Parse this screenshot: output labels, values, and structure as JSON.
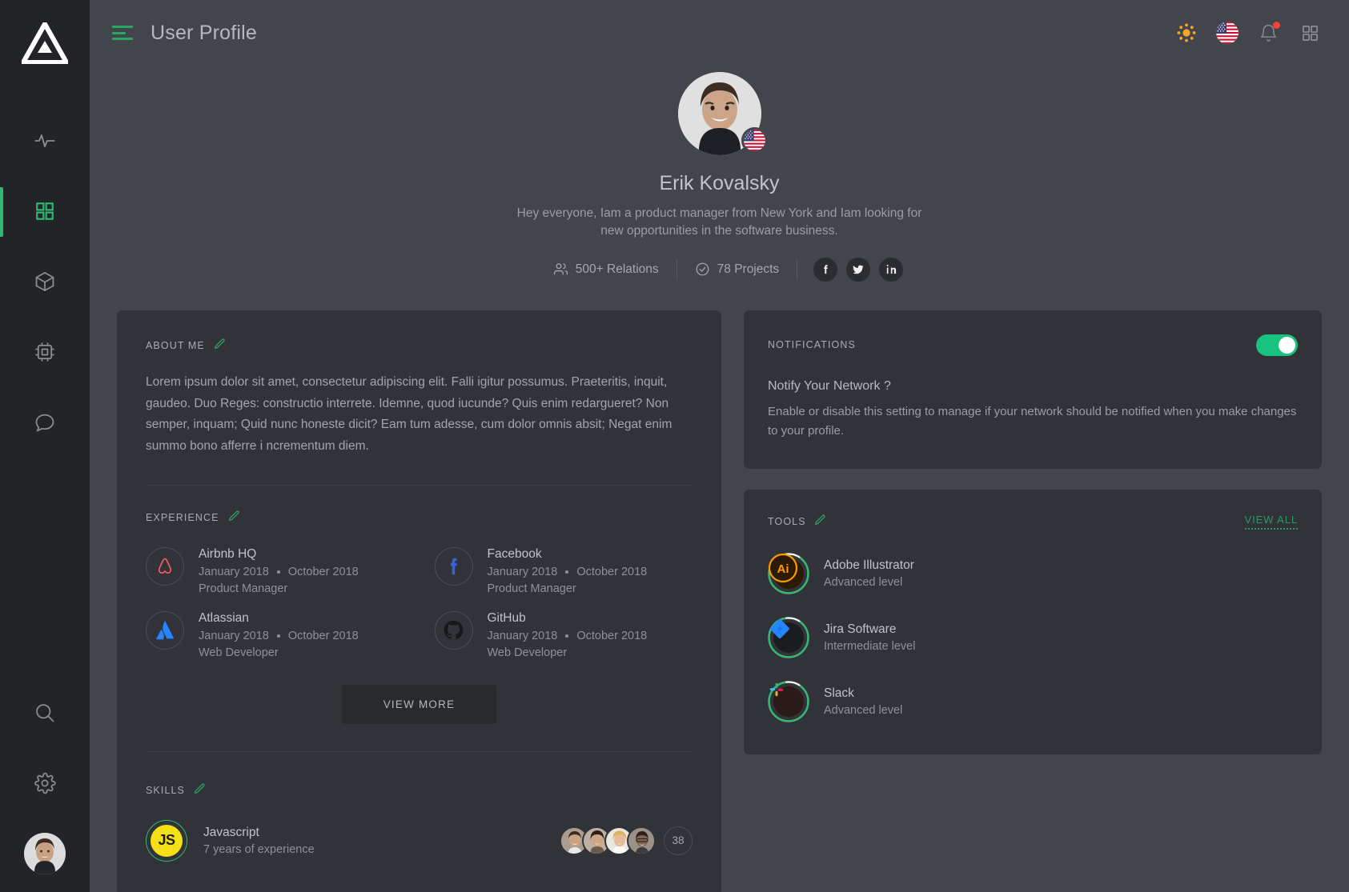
{
  "colors": {
    "accent": "#2eb872",
    "page_bg": "#43454d",
    "sidebar_bg": "#232427",
    "card_bg": "#313338",
    "toggle_on": "#18c37d",
    "notification_dot": "#f0453a"
  },
  "sidebar": {
    "logo": "triangle-logo",
    "items": [
      {
        "icon": "activity-icon",
        "name": "activity",
        "active": false
      },
      {
        "icon": "grid-icon",
        "name": "dashboard",
        "active": true
      },
      {
        "icon": "box-icon",
        "name": "packages",
        "active": false
      },
      {
        "icon": "cpu-icon",
        "name": "devices",
        "active": false
      },
      {
        "icon": "chat-icon",
        "name": "messages",
        "active": false
      }
    ],
    "bottom_items": [
      {
        "icon": "search-icon",
        "name": "search",
        "active": false
      },
      {
        "icon": "gear-icon",
        "name": "settings",
        "active": false
      }
    ],
    "avatar": "user-avatar"
  },
  "topbar": {
    "menu_icon": "hamburger-icon",
    "title": "User Profile",
    "actions": [
      {
        "icon": "sun-icon",
        "name": "brightness-toggle"
      },
      {
        "icon": "us-flag-icon",
        "name": "language-selector"
      },
      {
        "icon": "bell-icon",
        "name": "notifications",
        "badge": true
      },
      {
        "icon": "apps-grid-icon",
        "name": "apps-menu"
      }
    ]
  },
  "profile": {
    "name": "Erik Kovalsky",
    "bio": "Hey everyone,  Iam a product manager from New York and Iam looking for new opportunities in the software business.",
    "country_flag": "us-flag-icon",
    "stats": [
      {
        "icon": "users-icon",
        "label": "500+ Relations"
      },
      {
        "icon": "check-circle-icon",
        "label": "78 Projects"
      }
    ],
    "socials": [
      {
        "icon": "facebook-icon",
        "name": "facebook"
      },
      {
        "icon": "twitter-icon",
        "name": "twitter"
      },
      {
        "icon": "linkedin-icon",
        "name": "linkedin"
      }
    ]
  },
  "about": {
    "title": "ABOUT ME",
    "edit_icon": "pencil-icon",
    "text": "Lorem ipsum dolor sit amet, consectetur adipiscing elit. Falli igitur possumus. Praeteritis, inquit, gaudeo. Duo Reges: constructio interrete. Idemne, quod iucunde? Quis enim redargueret? Non semper, inquam; Quid nunc honeste dicit? Eam tum adesse, cum dolor omnis absit; Negat enim summo bono afferre i ncrementum diem."
  },
  "experience": {
    "title": "EXPERIENCE",
    "edit_icon": "pencil-icon",
    "items": [
      {
        "company": "Airbnb HQ",
        "logo": "airbnb-icon",
        "start": "January 2018",
        "end": "October 2018",
        "role": "Product Manager"
      },
      {
        "company": "Facebook",
        "logo": "facebook-icon",
        "start": "January 2018",
        "end": "October 2018",
        "role": "Product Manager"
      },
      {
        "company": "Atlassian",
        "logo": "atlassian-icon",
        "start": "January 2018",
        "end": "October 2018",
        "role": "Web Developer"
      },
      {
        "company": "GitHub",
        "logo": "github-icon",
        "start": "January 2018",
        "end": "October 2018",
        "role": "Web Developer"
      }
    ],
    "view_more_label": "VIEW MORE"
  },
  "skills": {
    "title": "SKILLS",
    "edit_icon": "pencil-icon",
    "items": [
      {
        "name": "Javascript",
        "logo": "js-icon",
        "logo_text": "JS",
        "experience": "7 years of experience",
        "people_count": "38",
        "avatars": [
          "avatar-1",
          "avatar-2",
          "avatar-3",
          "avatar-4"
        ]
      }
    ]
  },
  "notifications": {
    "title": "NOTIFICATIONS",
    "enabled": true,
    "question": "Notify Your Network ?",
    "description": "Enable or disable this setting to manage if your network should be notified when you make changes to your profile."
  },
  "tools": {
    "title": "TOOLS",
    "edit_icon": "pencil-icon",
    "view_all_label": "VIEW ALL",
    "items": [
      {
        "name": "Adobe Illustrator",
        "level": "Advanced level",
        "logo": "adobe-illustrator-icon",
        "progress": 88
      },
      {
        "name": "Jira Software",
        "level": "Intermediate level",
        "logo": "jira-icon",
        "progress": 88
      },
      {
        "name": "Slack",
        "level": "Advanced level",
        "logo": "slack-icon",
        "progress": 88
      }
    ]
  }
}
